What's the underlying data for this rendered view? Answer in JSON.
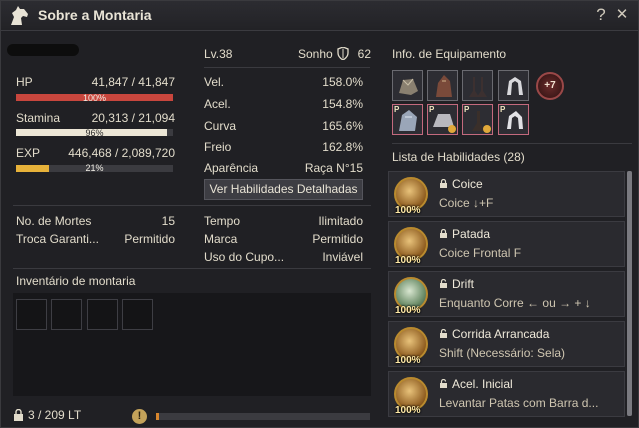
{
  "window": {
    "title": "Sobre a Montaria",
    "help_label": "?",
    "close_label": "✕"
  },
  "mount": {
    "level": "Lv.38",
    "sonho_label": "Sonho",
    "sonho_value": "62"
  },
  "bars": {
    "hp": {
      "label": "HP",
      "value": "41,847 / 41,847",
      "percent_text": "100%",
      "fill": 1.0,
      "color": "#c8463d"
    },
    "stamina": {
      "label": "Stamina",
      "value": "20,313 / 21,094",
      "percent_text": "96%",
      "fill": 0.96,
      "color": "#ece6d6"
    },
    "exp": {
      "label": "EXP",
      "value": "446,468 / 2,089,720",
      "percent_text": "21%",
      "fill": 0.21,
      "color": "#e7b23a"
    }
  },
  "attributes": [
    {
      "label": "Vel.",
      "value": "158.0%"
    },
    {
      "label": "Acel.",
      "value": "154.8%"
    },
    {
      "label": "Curva",
      "value": "165.6%"
    },
    {
      "label": "Freio",
      "value": "162.8%"
    },
    {
      "label": "Aparência",
      "value": "Raça N°15"
    }
  ],
  "detail_button": "Ver Habilidades Detalhadas",
  "info_left": [
    {
      "label": "No. de Mortes",
      "value": "15"
    },
    {
      "label": "Troca Garanti...",
      "value": "Permitido"
    }
  ],
  "info_right": [
    {
      "label": "Tempo",
      "value": "Ilimitado"
    },
    {
      "label": "Marca",
      "value": "Permitido"
    },
    {
      "label": "Uso do Cupo...",
      "value": "Inviável"
    }
  ],
  "inventory": {
    "title": "Inventário de montaria",
    "weight": "3 / 209 LT",
    "weight_fill": 0.014
  },
  "equipment": {
    "title": "Info. de Equipamento",
    "badge": "+7",
    "p_marker": "P"
  },
  "skills": {
    "title": "Lista de Habilidades (28)",
    "items": [
      {
        "name": "Coice",
        "command": "Coice ↓+F",
        "percent": "100%",
        "locked": true
      },
      {
        "name": "Patada",
        "command": "Coice Frontal F",
        "percent": "100%",
        "locked": true
      },
      {
        "name": "Drift",
        "command": "Enquanto Corre ← ou → + ↓",
        "percent": "100%",
        "locked": false
      },
      {
        "name": "Corrida Arrancada",
        "command": "Shift (Necessário: Sela)",
        "percent": "100%",
        "locked": false
      },
      {
        "name": "Acel. Inicial",
        "command": "Levantar Patas com Barra d...",
        "percent": "100%",
        "locked": false
      }
    ]
  }
}
